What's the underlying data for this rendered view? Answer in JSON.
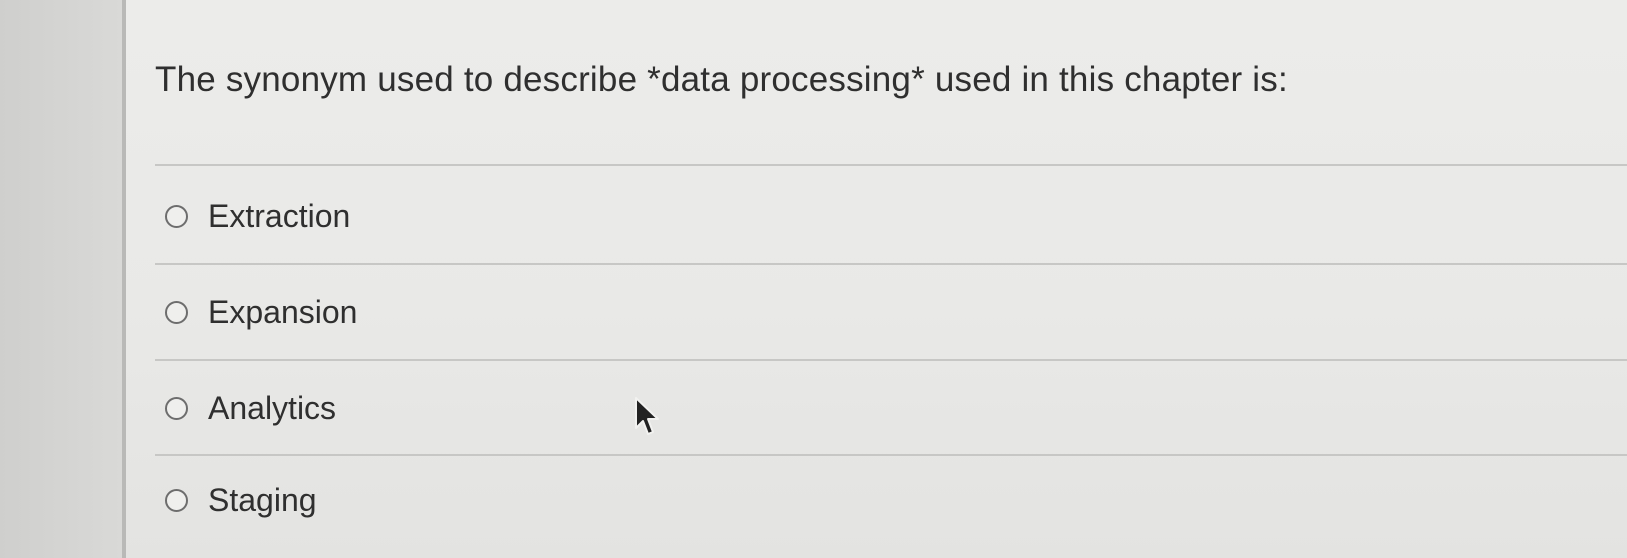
{
  "question": {
    "text": "The synonym used to describe *data processing* used in this chapter is:"
  },
  "answers": [
    {
      "label": "Extraction",
      "selected": false
    },
    {
      "label": "Expansion",
      "selected": false
    },
    {
      "label": "Analytics",
      "selected": false
    },
    {
      "label": "Staging",
      "selected": false
    }
  ],
  "colors": {
    "page_background": "#dcdcda",
    "panel_background": "#ebebe9",
    "text": "#2f2f2f",
    "divider": "#c7c7c5",
    "radio_border": "#6d6d6d"
  },
  "icons": {
    "radio": "radio-unchecked-icon",
    "cursor": "mouse-pointer-icon"
  }
}
